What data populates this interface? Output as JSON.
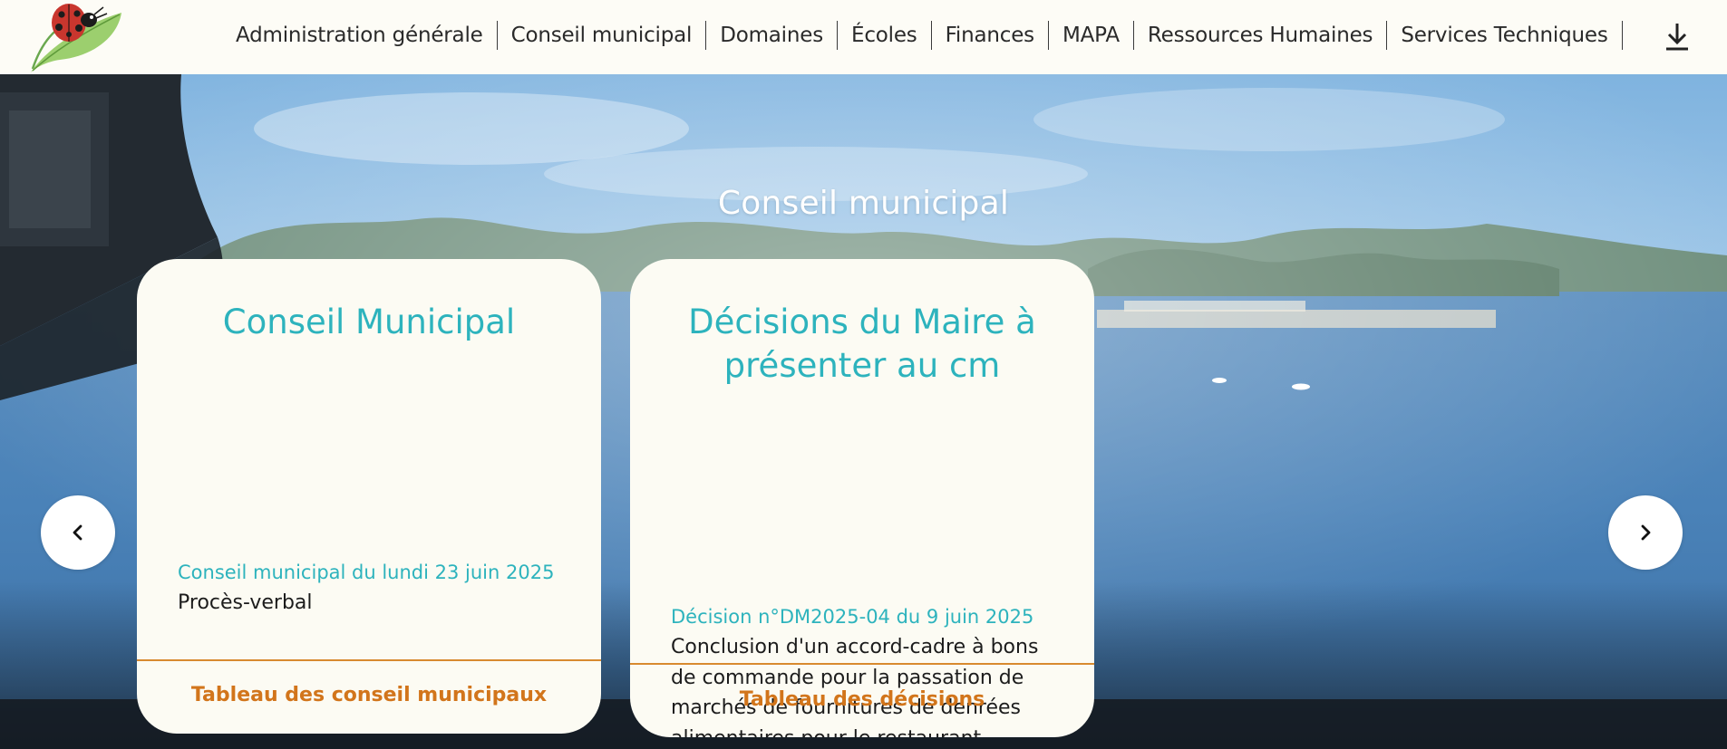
{
  "header": {
    "nav": [
      "Administration générale",
      "Conseil municipal",
      "Domaines",
      "Écoles",
      "Finances",
      "MAPA",
      "Ressources Humaines",
      "Services Techniques"
    ],
    "logo_icon": "ladybug-on-leaf-icon",
    "download_icon": "download-icon"
  },
  "hero": {
    "title": "Conseil municipal",
    "cards": [
      {
        "title": "Conseil Municipal",
        "link": "Conseil municipal du lundi 23 juin 2025",
        "text": "Procès-verbal",
        "footer": "Tableau des conseil municipaux"
      },
      {
        "title": "Décisions du Maire à présenter au cm",
        "link": "Décision n°DM2025-04 du 9 juin 2025",
        "text": "Conclusion d'un accord-cadre à bons de commande pour la passation de marchés de fournitures de denrées alimentaires pour le restaurant scolaire",
        "footer": "Tableau des décisions"
      }
    ],
    "prev_icon": "chevron-left-icon",
    "next_icon": "chevron-right-icon"
  },
  "colors": {
    "header_bg": "#fdfcf6",
    "card_bg": "#fcfbf3",
    "accent_teal": "#2db3bd",
    "accent_orange": "#d2751b"
  }
}
